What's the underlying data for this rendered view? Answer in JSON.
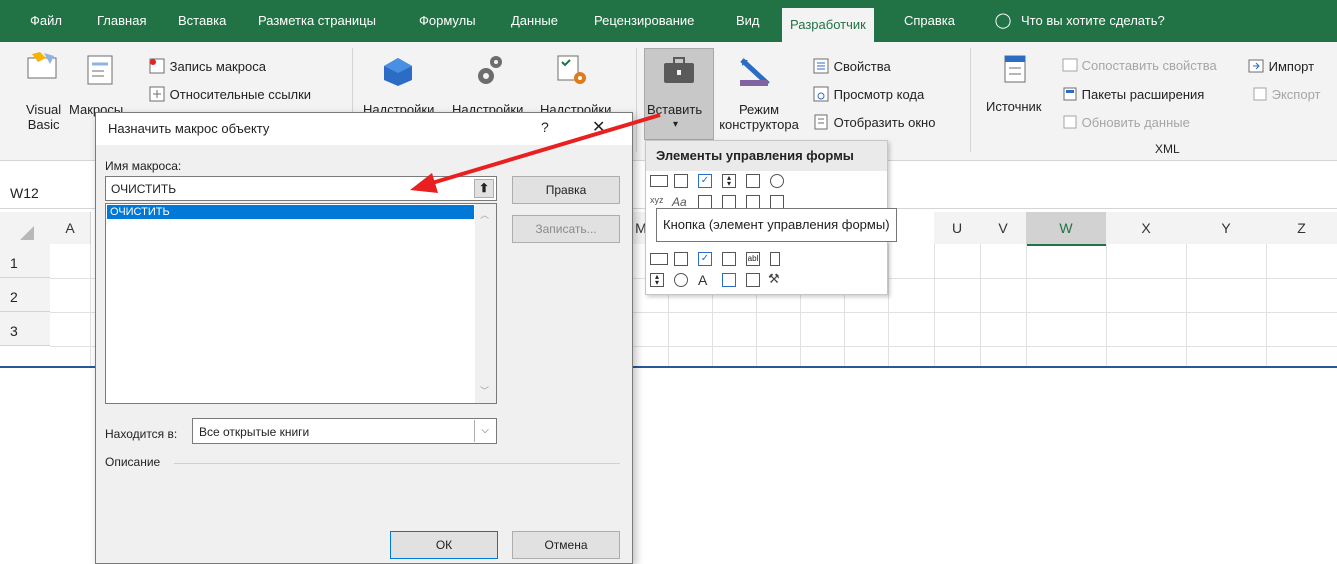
{
  "excel": {
    "menu_tabs": [
      {
        "label": "Файл"
      },
      {
        "label": "Главная"
      },
      {
        "label": "Вставка"
      },
      {
        "label": "Разметка страницы"
      },
      {
        "label": "Формулы"
      },
      {
        "label": "Данные"
      },
      {
        "label": "Рецензирование"
      },
      {
        "label": "Вид"
      },
      {
        "label": "Разработчик"
      },
      {
        "label": "Справка"
      }
    ],
    "tell_me": "Что вы хотите сделать?",
    "ribbon": {
      "visual_basic_line1": "Visual",
      "visual_basic_line2": "Basic",
      "macros": "Макросы",
      "record_macro": "Запись макроса",
      "relative_refs": "Относительные ссылки",
      "addins": "Надстройки",
      "insert": "Вставить",
      "design_mode_line1": "Режим",
      "design_mode_line2": "конструктора",
      "properties": "Свойства",
      "view_code": "Просмотр кода",
      "show_window": "Отобразить окно",
      "source": "Источник",
      "map_properties": "Сопоставить свойства",
      "expansion_packs": "Пакеты расширения",
      "refresh_data": "Обновить данные",
      "import": "Импорт",
      "export": "Экспорт",
      "xml_group": "XML"
    },
    "name_box": "W12",
    "columns": [
      "A",
      "M",
      "U",
      "V",
      "W",
      "X",
      "Y",
      "Z"
    ],
    "rows": [
      "1",
      "2",
      "3"
    ]
  },
  "controls_menu": {
    "header": "Элементы управления формы",
    "tooltip": "Кнопка (элемент управления формы)"
  },
  "dialog": {
    "title": "Назначить макрос объекту",
    "help": "?",
    "close": "✕",
    "macro_name_label": "Имя макроса:",
    "macro_name_value": "ОЧИСТИТЬ",
    "macro_list": [
      "ОЧИСТИТЬ"
    ],
    "edit_button": "Правка",
    "record_button": "Записать...",
    "located_in_label": "Находится в:",
    "located_in_value": "Все открытые книги",
    "description_label": "Описание",
    "ok_button": "ОК",
    "cancel_button": "Отмена"
  },
  "colors": {
    "excel_green": "#217346",
    "selection_blue": "#0078d7",
    "arrow_red": "#e8201f"
  }
}
